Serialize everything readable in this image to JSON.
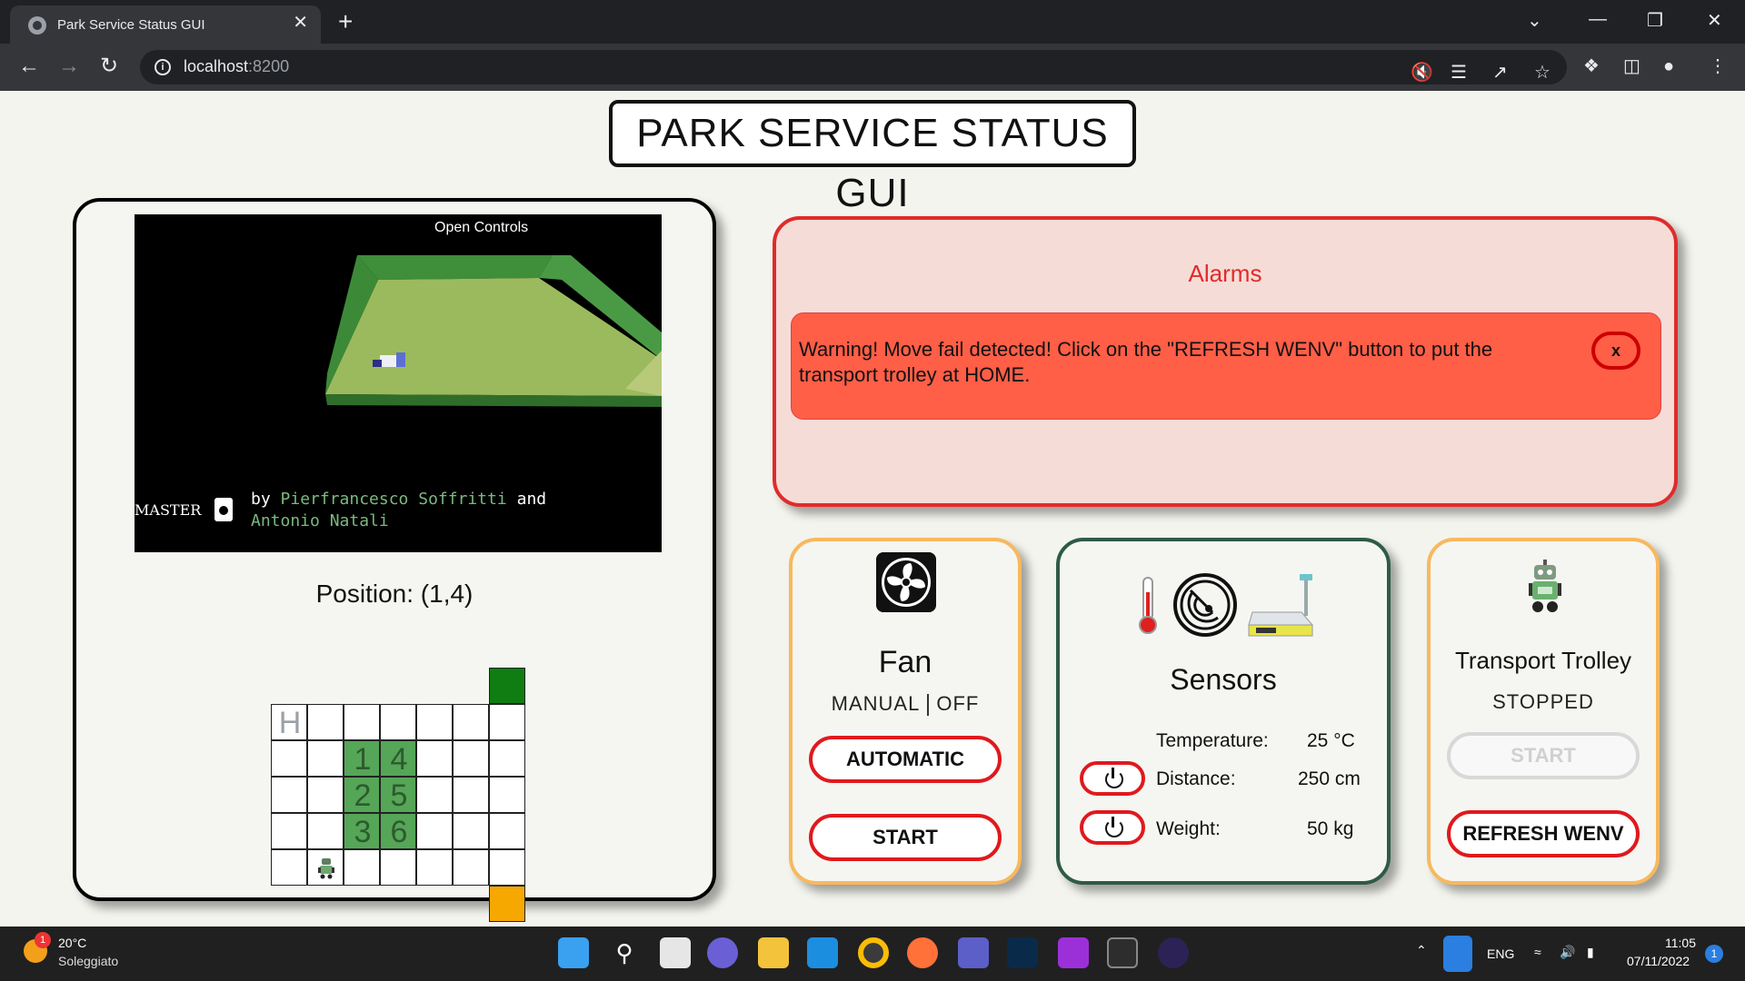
{
  "browser": {
    "tab_title": "Park Service Status GUI",
    "tab_close": "✕",
    "new_tab": "+",
    "url_host": "localhost",
    "url_port": ":8200",
    "window_controls": [
      "⌄",
      "—",
      "❐",
      "✕"
    ]
  },
  "page": {
    "title": "PARK SERVICE STATUS GUI"
  },
  "scene": {
    "open_controls": "Open Controls",
    "master": "MASTER",
    "credits_by": "by ",
    "author1": "Pierfrancesco Soffritti",
    "credits_and": " and",
    "author2": "Antonio Natali"
  },
  "position": {
    "label": "Position: (1,4)",
    "home_label": "H",
    "slots": [
      "1",
      "4",
      "2",
      "5",
      "3",
      "6"
    ]
  },
  "alarms": {
    "title": "Alarms",
    "message": "Warning! Move fail detected! Click on the \"REFRESH WENV\" button to put the transport trolley at HOME.",
    "close_label": "x"
  },
  "fan": {
    "title": "Fan",
    "mode_manual": "MANUAL",
    "mode_off": "OFF",
    "automatic_button": "AUTOMATIC",
    "start_button": "START"
  },
  "sensors": {
    "title": "Sensors",
    "temperature_label": "Temperature:",
    "temperature_value": "25 °C",
    "distance_label": "Distance:",
    "distance_value": "250 cm",
    "weight_label": "Weight:",
    "weight_value": "50 kg"
  },
  "trolley": {
    "title": "Transport Trolley",
    "status": "STOPPED",
    "start_button": "START",
    "refresh_button": "REFRESH WENV"
  },
  "taskbar": {
    "weather_badge": "1",
    "weather_temp": "20°C",
    "weather_desc": "Soleggiato",
    "language": "ENG",
    "time": "11:05",
    "date": "07/11/2022",
    "notification_count": "1"
  },
  "colors": {
    "alarm_red": "#e02b2b",
    "alarm_box": "#ff5e47",
    "button_border": "#e0191d",
    "card_orange": "#f8b85e",
    "card_green": "#2f5a48",
    "cell_green": "#55a657",
    "cell_dark_green": "#0f7d12",
    "cell_orange": "#f6a700"
  }
}
